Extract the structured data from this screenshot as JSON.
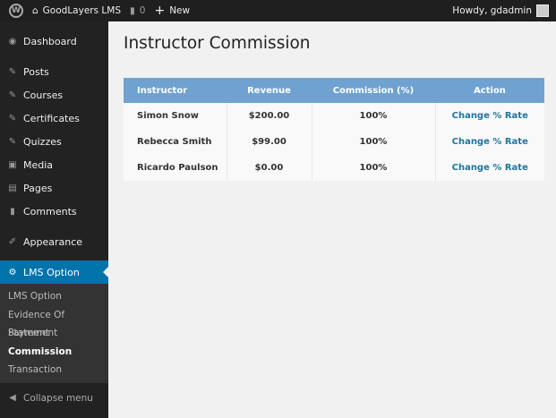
{
  "topbar": {
    "site": "GoodLayers LMS",
    "comments": "0",
    "new": "New",
    "howdy": "Howdy, gdadmin"
  },
  "sidebar": {
    "items": [
      {
        "label": "Dashboard",
        "icon": "dashboard-icon"
      },
      {
        "label": "Posts",
        "icon": "pin-icon"
      },
      {
        "label": "Courses",
        "icon": "pin-icon"
      },
      {
        "label": "Certificates",
        "icon": "pin-icon"
      },
      {
        "label": "Quizzes",
        "icon": "pin-icon"
      },
      {
        "label": "Media",
        "icon": "media-icon"
      },
      {
        "label": "Pages",
        "icon": "pages-icon"
      },
      {
        "label": "Comments",
        "icon": "comment-icon"
      },
      {
        "label": "Appearance",
        "icon": "brush-icon"
      },
      {
        "label": "LMS Option",
        "icon": "gear-icon"
      }
    ],
    "submenu": [
      "LMS Option",
      "Evidence Of Payment",
      "Statement",
      "Commission",
      "Transaction"
    ],
    "collapse": "Collapse menu"
  },
  "page": {
    "title": "Instructor Commission"
  },
  "table": {
    "headers": [
      "Instructor",
      "Revenue",
      "Commission (%)",
      "Action"
    ],
    "rows": [
      [
        "Simon Snow",
        "$200.00",
        "100%",
        "Change % Rate"
      ],
      [
        "Rebecca Smith",
        "$99.00",
        "100%",
        "Change % Rate"
      ],
      [
        "Ricardo Paulson",
        "$0.00",
        "100%",
        "Change % Rate"
      ]
    ]
  },
  "colors": {
    "accent": "#0073aa",
    "table_header": "#6fa2d0",
    "link": "#21759b"
  }
}
